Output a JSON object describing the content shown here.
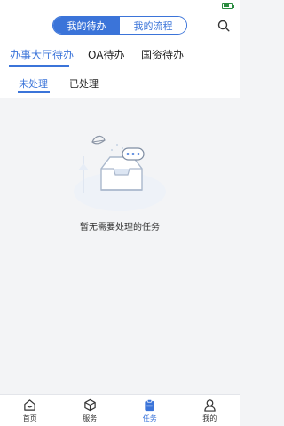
{
  "header": {
    "segments": [
      {
        "label": "我的待办",
        "active": true
      },
      {
        "label": "我的流程",
        "active": false
      }
    ],
    "search_icon": "search-icon"
  },
  "tabs": [
    {
      "label": "办事大厅待办",
      "active": true
    },
    {
      "label": "OA待办",
      "active": false
    },
    {
      "label": "国资待办",
      "active": false
    }
  ],
  "subtabs": [
    {
      "label": "未处理",
      "active": true
    },
    {
      "label": "已处理",
      "active": false
    }
  ],
  "empty_state": {
    "message": "暂无需要处理的任务",
    "icon": "empty-inbox-icon"
  },
  "bottom_nav": [
    {
      "label": "首页",
      "icon": "home-icon",
      "active": false
    },
    {
      "label": "服务",
      "icon": "cube-icon",
      "active": false
    },
    {
      "label": "任务",
      "icon": "clipboard-icon",
      "active": true
    },
    {
      "label": "我的",
      "icon": "user-icon",
      "active": false
    }
  ],
  "colors": {
    "accent": "#3b74d9",
    "background": "#f3f4f6",
    "battery": "#2a8c3f"
  }
}
